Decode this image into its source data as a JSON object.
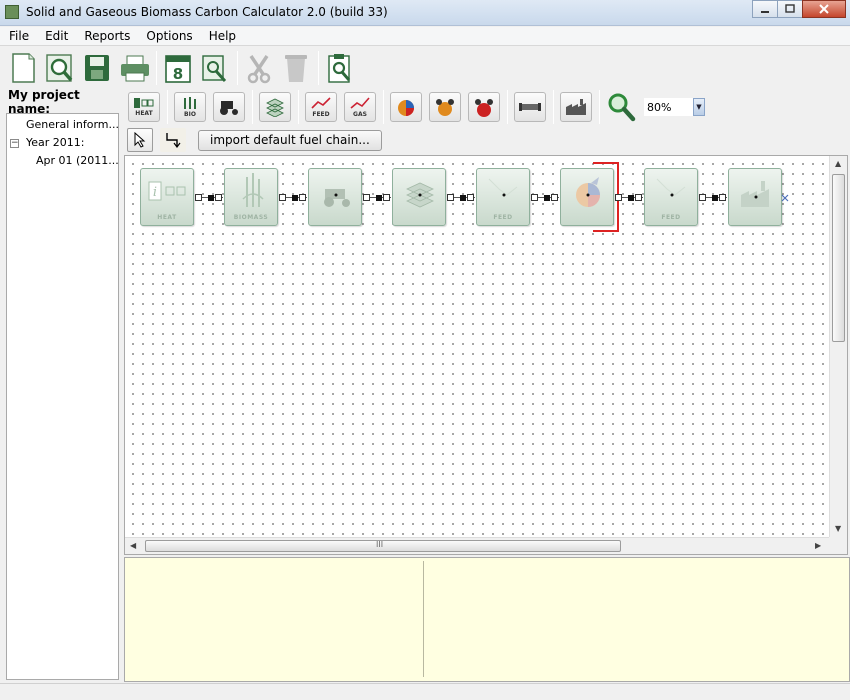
{
  "window": {
    "title": "Solid and Gaseous Biomass Carbon Calculator 2.0 (build 33)",
    "controls": [
      "minimize",
      "maximize",
      "close"
    ]
  },
  "menu": [
    "File",
    "Edit",
    "Reports",
    "Options",
    "Help"
  ],
  "toolbar_main": [
    "new-document-icon",
    "preview-icon",
    "save-icon",
    "print-icon",
    "calendar-icon",
    "schedule-edit-icon",
    "cut-icon",
    "delete-icon",
    "clipboard-search-icon"
  ],
  "calendar_day": "8",
  "project": {
    "label": "My project name:",
    "tree": [
      {
        "label": "General inform...",
        "level": 1
      },
      {
        "label": "Year 2011:",
        "level": 1,
        "expanded": true
      },
      {
        "label": "Apr 01 (2011...",
        "level": 2
      }
    ],
    "toggle": "−"
  },
  "module_toolbar": [
    {
      "icon": "heat-module-icon",
      "label": "HEAT"
    },
    {
      "icon": "biomass-module-icon",
      "label": "BIO"
    },
    {
      "icon": "tractor-icon",
      "label": ""
    },
    {
      "icon": "stacked-layers-icon",
      "label": ""
    },
    {
      "icon": "feed-chart-icon",
      "label": "FEED"
    },
    {
      "icon": "gas-chart-icon",
      "label": "GAS"
    },
    {
      "icon": "pie-arrow-icon",
      "label": ""
    },
    {
      "icon": "pie-dots-icon",
      "label": ""
    },
    {
      "icon": "pie-dots-alt-icon",
      "label": ""
    },
    {
      "icon": "pipe-icon",
      "label": ""
    },
    {
      "icon": "factory-icon",
      "label": ""
    }
  ],
  "zoom": {
    "value": "80%"
  },
  "chain_toolbar": {
    "import_label": "import default fuel chain..."
  },
  "chain": [
    {
      "name": "heat",
      "label": "HEAT",
      "icon": "heat-block-icon"
    },
    {
      "name": "biomass",
      "label": "BIOMASS",
      "icon": "biomass-block-icon"
    },
    {
      "name": "harvest",
      "label": "",
      "icon": "tractor-block-icon"
    },
    {
      "name": "storage",
      "label": "",
      "icon": "storage-block-icon"
    },
    {
      "name": "feed-1",
      "label": "FEED",
      "icon": "feed-block-icon"
    },
    {
      "name": "conversion",
      "label": "",
      "icon": "pie-arrow-block-icon"
    },
    {
      "name": "feed-2",
      "label": "FEED",
      "icon": "feed-block-icon"
    },
    {
      "name": "plant",
      "label": "",
      "icon": "factory-block-icon"
    }
  ],
  "scroll": {
    "grip": "III"
  }
}
